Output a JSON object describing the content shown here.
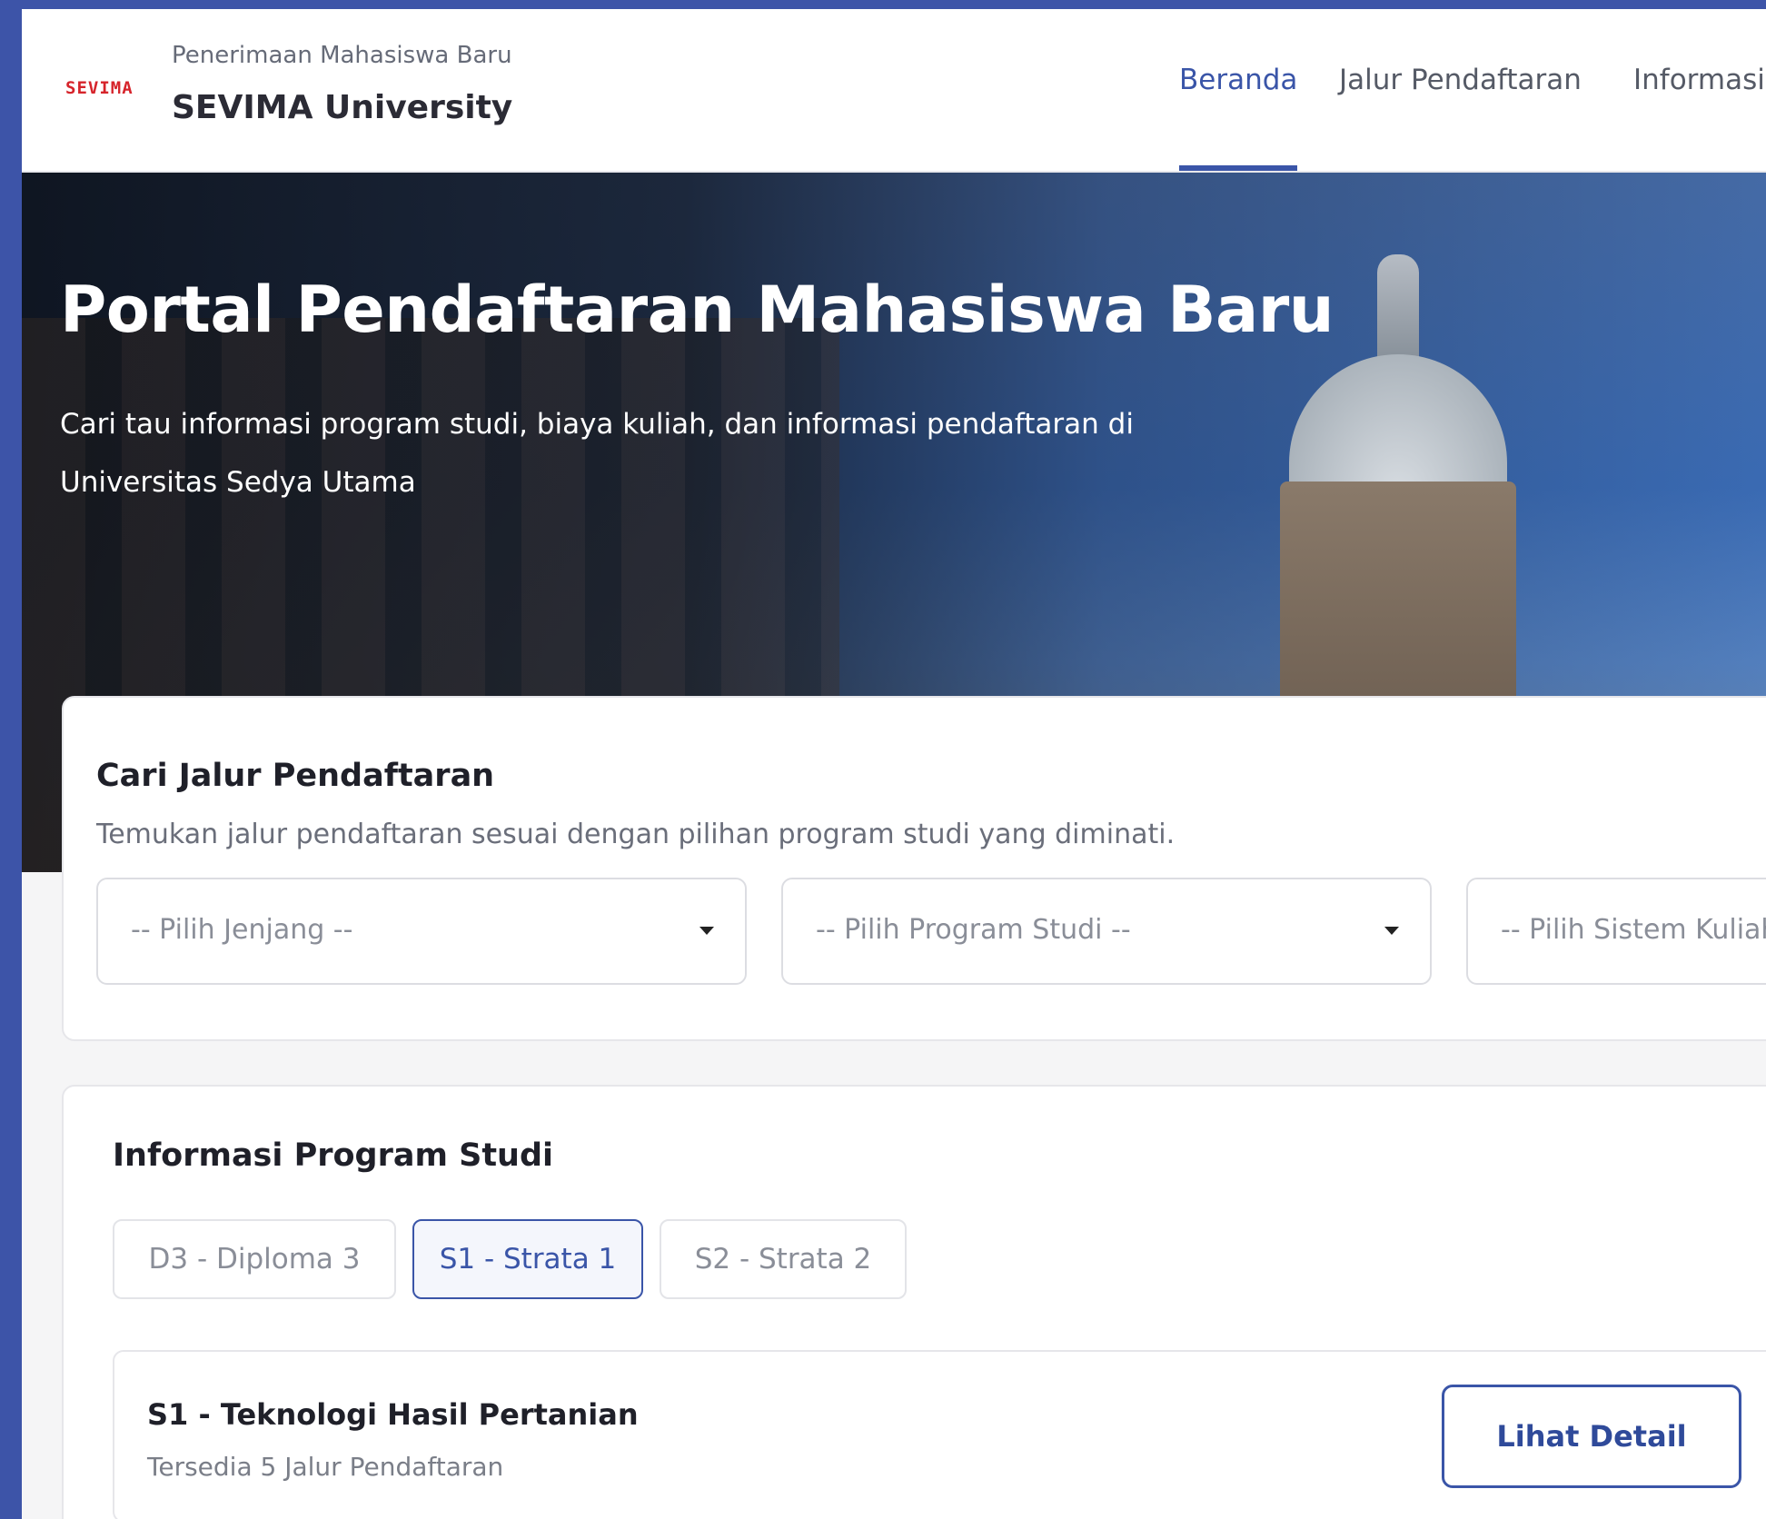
{
  "header": {
    "logo_text": "SEVIMA",
    "subtitle": "Penerimaan Mahasiswa Baru",
    "title": "SEVIMA University",
    "nav": [
      "Beranda",
      "Jalur Pendaftaran",
      "Informasi"
    ],
    "active_nav": "Beranda"
  },
  "hero": {
    "title": "Portal Pendaftaran Mahasiswa Baru",
    "description": "Cari tau informasi program studi, biaya kuliah, dan informasi pendaftaran di Universitas Sedya Utama"
  },
  "search": {
    "title": "Cari Jalur Pendaftaran",
    "subtitle": "Temukan jalur pendaftaran sesuai dengan pilihan program studi yang diminati.",
    "selects": [
      {
        "placeholder": "-- Pilih Jenjang --"
      },
      {
        "placeholder": "-- Pilih Program Studi --"
      },
      {
        "placeholder": "-- Pilih Sistem Kuliah --"
      }
    ]
  },
  "program_info": {
    "title": "Informasi Program Studi",
    "tabs": [
      "D3 - Diploma 3",
      "S1 - Strata 1",
      "S2 - Strata 2"
    ],
    "active_tab": "S1 - Strata 1",
    "items": [
      {
        "name": "S1 - Teknologi Hasil Pertanian",
        "availability": "Tersedia 5 Jalur Pendaftaran",
        "button": "Lihat Detail"
      }
    ]
  },
  "colors": {
    "accent": "#3a55a8",
    "frame": "#3d54a8",
    "logo": "#d6242b"
  }
}
